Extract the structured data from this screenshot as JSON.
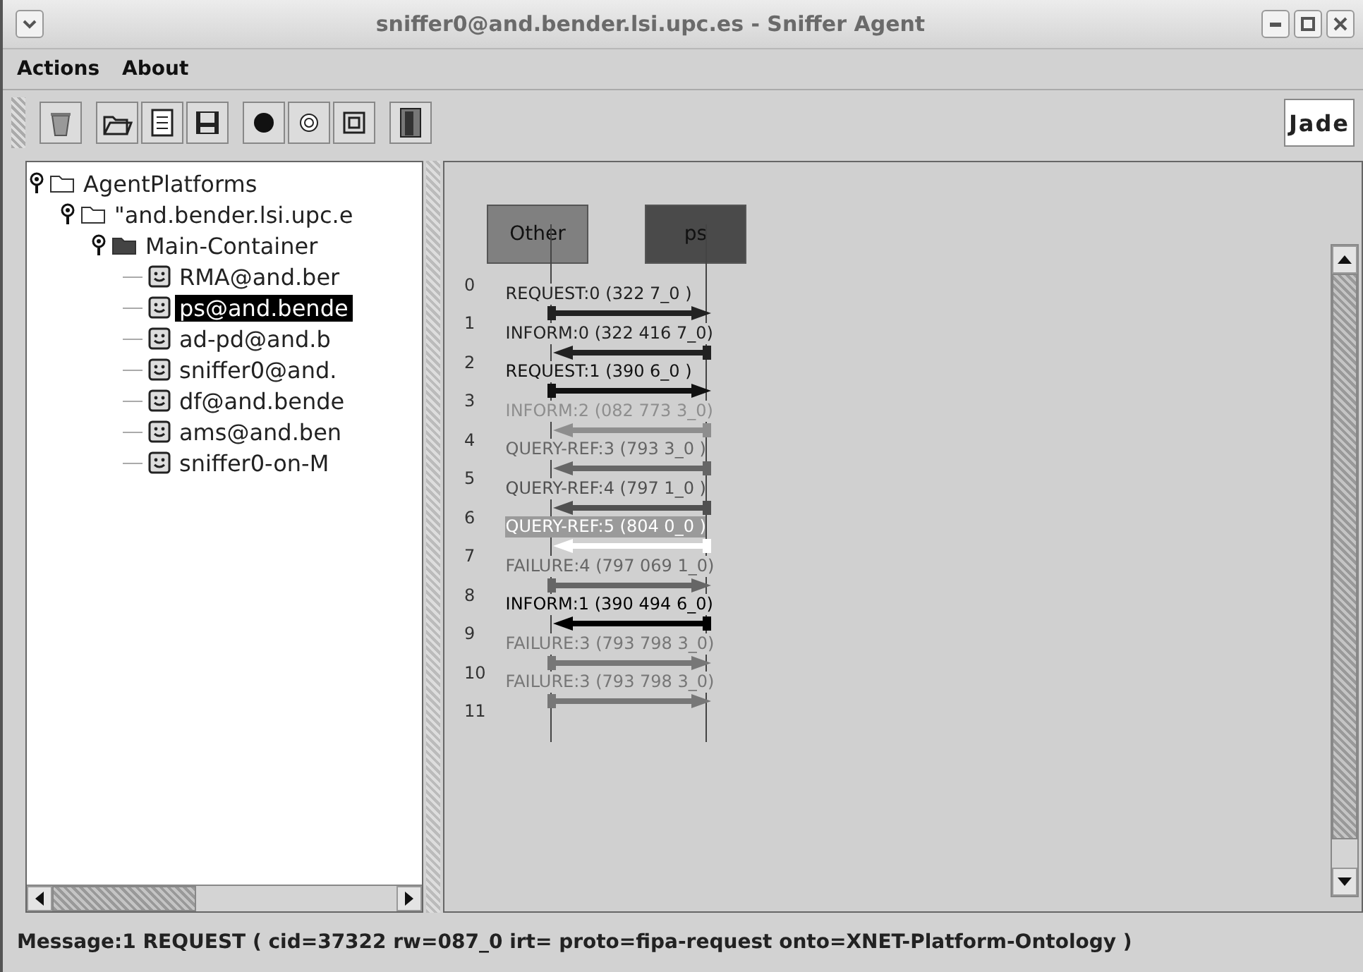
{
  "window": {
    "title": "sniffer0@and.bender.lsi.upc.es - Sniffer Agent"
  },
  "menu": [
    {
      "label": "Actions"
    },
    {
      "label": "About"
    }
  ],
  "toolbar": {
    "logo_text": "Jade"
  },
  "tree": [
    {
      "label": "AgentPlatforms",
      "kind": "folder",
      "expanded": true,
      "children": [
        {
          "label": "\"and.bender.lsi.upc.e",
          "kind": "folder",
          "expanded": true,
          "children": [
            {
              "label": "Main-Container",
              "kind": "container",
              "expanded": true,
              "children": [
                {
                  "label": "RMA@and.ber",
                  "kind": "agent",
                  "selected": false
                },
                {
                  "label": "ps@and.bende",
                  "kind": "agent",
                  "selected": true
                },
                {
                  "label": "ad-pd@and.b",
                  "kind": "agent",
                  "selected": false
                },
                {
                  "label": "sniffer0@and.",
                  "kind": "agent",
                  "selected": false
                },
                {
                  "label": "df@and.bende",
                  "kind": "agent",
                  "selected": false
                },
                {
                  "label": "ams@and.ben",
                  "kind": "agent",
                  "selected": false
                },
                {
                  "label": "sniffer0-on-M",
                  "kind": "agent",
                  "selected": false
                }
              ]
            }
          ]
        }
      ]
    }
  ],
  "diagram": {
    "agents": [
      {
        "name": "Other",
        "color": "#808080"
      },
      {
        "name": "ps",
        "color": "#4a4a4a"
      }
    ],
    "row_numbers": [
      "0",
      "1",
      "2",
      "3",
      "4",
      "5",
      "6",
      "7",
      "8",
      "9",
      "10",
      "11"
    ],
    "messages": [
      {
        "label": "REQUEST:0 (322  7_0   )",
        "kind": "outgoing",
        "color": "#222222"
      },
      {
        "label": "INFORM:0 (322  416  7_0)",
        "kind": "incoming",
        "color": "#222222"
      },
      {
        "label": "REQUEST:1 (390  6_0   )",
        "kind": "outgoing",
        "color": "#111111"
      },
      {
        "label": "INFORM:2 (082  773  3_0)",
        "kind": "incoming",
        "color": "#8e8e8e"
      },
      {
        "label": "QUERY-REF:3 (793  3_0   )",
        "kind": "incoming",
        "color": "#666666"
      },
      {
        "label": "QUERY-REF:4 (797  1_0   )",
        "kind": "incoming",
        "color": "#505050"
      },
      {
        "label": "QUERY-REF:5 (804  0_0   )",
        "kind": "incoming",
        "color": "#ffffff"
      },
      {
        "label": "FAILURE:4 (797  069  1_0)",
        "kind": "outgoing",
        "color": "#666666"
      },
      {
        "label": "INFORM:1 (390  494  6_0)",
        "kind": "incoming",
        "color": "#000000"
      },
      {
        "label": "FAILURE:3 (793  798  3_0)",
        "kind": "outgoing",
        "color": "#777777"
      },
      {
        "label": "FAILURE:3 (793  798  3_0)",
        "kind": "outgoing",
        "color": "#777777"
      }
    ]
  },
  "status_bar": "Message:1 REQUEST ( cid=37322 rw=087_0 irt=   proto=fipa-request onto=XNET-Platform-Ontology )"
}
